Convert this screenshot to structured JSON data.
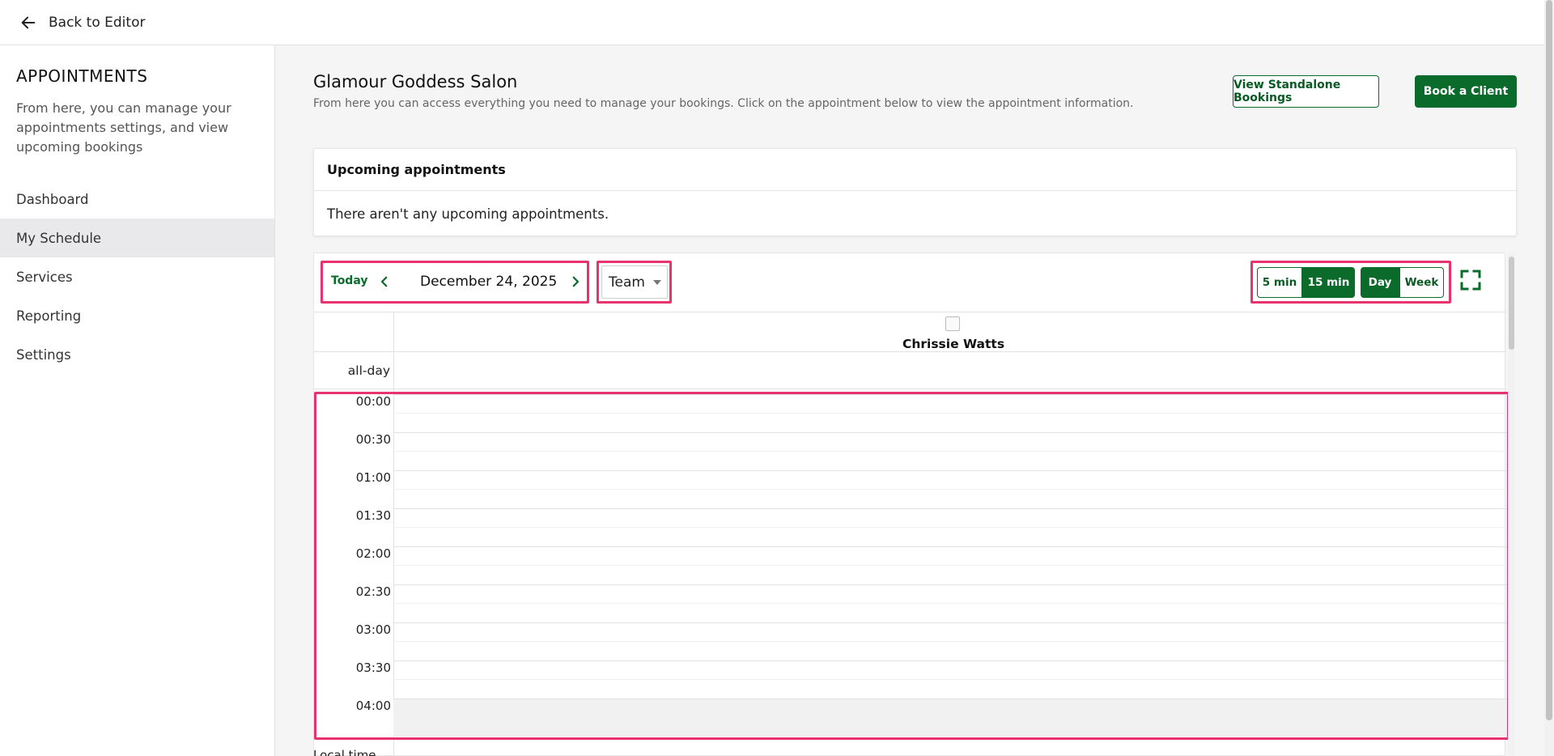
{
  "topbar": {
    "back_label": "Back to Editor"
  },
  "sidebar": {
    "title": "APPOINTMENTS",
    "description": "From here, you can manage your appointments settings, and view upcoming bookings",
    "items": [
      {
        "label": "Dashboard",
        "active": false
      },
      {
        "label": "My Schedule",
        "active": true
      },
      {
        "label": "Services",
        "active": false
      },
      {
        "label": "Reporting",
        "active": false
      },
      {
        "label": "Settings",
        "active": false
      }
    ]
  },
  "header": {
    "title": "Glamour Goddess Salon",
    "subtitle": "From here you can access everything you need to manage your bookings. Click on the appointment below to view the appointment information.",
    "standalone_button": "View Standalone Bookings",
    "book_button": "Book a Client"
  },
  "upcoming": {
    "heading": "Upcoming appointments",
    "empty_text": "There aren't any upcoming appointments."
  },
  "calendar": {
    "today_label": "Today",
    "date": "December 24, 2025",
    "team_select": "Team",
    "interval_options": [
      "5 min",
      "15 min"
    ],
    "interval_selected": "15 min",
    "view_options": [
      "Day",
      "Week"
    ],
    "view_selected": "Day",
    "staff_name": "Chrissie Watts",
    "allday_label": "all-day",
    "times": [
      "00:00",
      "00:30",
      "01:00",
      "01:30",
      "02:00",
      "02:30",
      "03:00",
      "03:30",
      "04:00"
    ],
    "local_time_label": "Local time"
  },
  "colors": {
    "accent": "#0a6b2a",
    "highlight": "#e8336f",
    "sidebar_active": "#e9e9ec"
  }
}
